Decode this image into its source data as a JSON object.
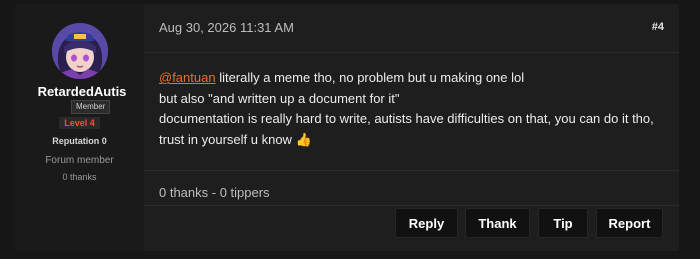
{
  "author": {
    "username": "RetardedAutist",
    "badge": "Member",
    "level": "Level 4",
    "reputation": "Reputation 0",
    "role": "Forum member",
    "thanks": "0 thanks"
  },
  "post": {
    "date": "Aug 30, 2026 11:31 AM",
    "number": "#4",
    "mention": "@fantuan",
    "line1_rest": " literally a meme tho, no problem but u making one lol",
    "line2": "but also \"and written up a document for it\"",
    "line3": "documentation is really hard to write, autists have difficulties on that, you can do it tho, trust in yourself u know",
    "emoji": "👍",
    "stats": "0 thanks - 0 tippers"
  },
  "actions": {
    "reply": "Reply",
    "thank": "Thank",
    "tip": "Tip",
    "report": "Report"
  },
  "colors": {
    "mention": "#e8702a",
    "level": "#ff4a2a",
    "background": "#1e1e1e"
  }
}
